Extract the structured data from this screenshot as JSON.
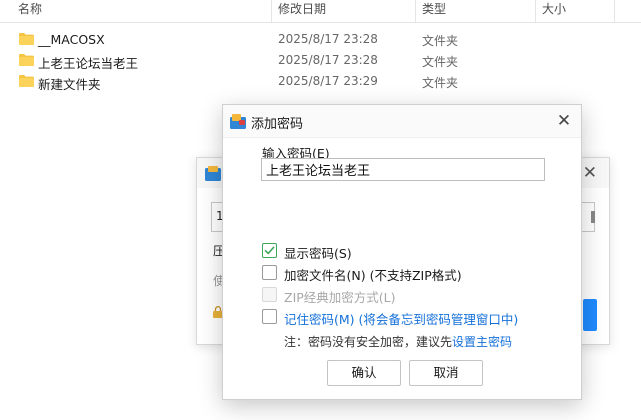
{
  "explorer": {
    "columns": {
      "name": "名称",
      "date": "修改日期",
      "type": "类型",
      "size": "大小"
    },
    "rows": [
      {
        "name": "__MACOSX",
        "date": "2025/8/17 23:28",
        "type": "文件夹"
      },
      {
        "name": "上老王论坛当老王",
        "date": "2025/8/17 23:28",
        "type": "文件夹"
      },
      {
        "name": "新建文件夹",
        "date": "2025/8/17 23:29",
        "type": "文件夹"
      }
    ],
    "folder_color": "#f5c443"
  },
  "under_dialog": {
    "input_value": "1",
    "line1": "压",
    "line2": "使"
  },
  "dialog": {
    "title": "添加密码",
    "password_label": "输入密码(E)",
    "password_value": "上老王论坛当老王",
    "options": {
      "show_password": {
        "label": "显示密码(S)",
        "checked": true
      },
      "encrypt_filenames": {
        "label": "加密文件名(N) (不支持ZIP格式)",
        "checked": false
      },
      "zip_legacy": {
        "label": "ZIP经典加密方式(L)",
        "checked": false,
        "disabled": true
      },
      "remember": {
        "label": "记住密码(M) (将会备忘到密码管理窗口中)",
        "checked": false
      }
    },
    "note_prefix": "注：密码没有安全加密，建议先",
    "note_link": "设置主密码",
    "ok_label": "确认",
    "cancel_label": "取消",
    "link_color": "#1470d8",
    "check_color": "#3ea55a"
  }
}
